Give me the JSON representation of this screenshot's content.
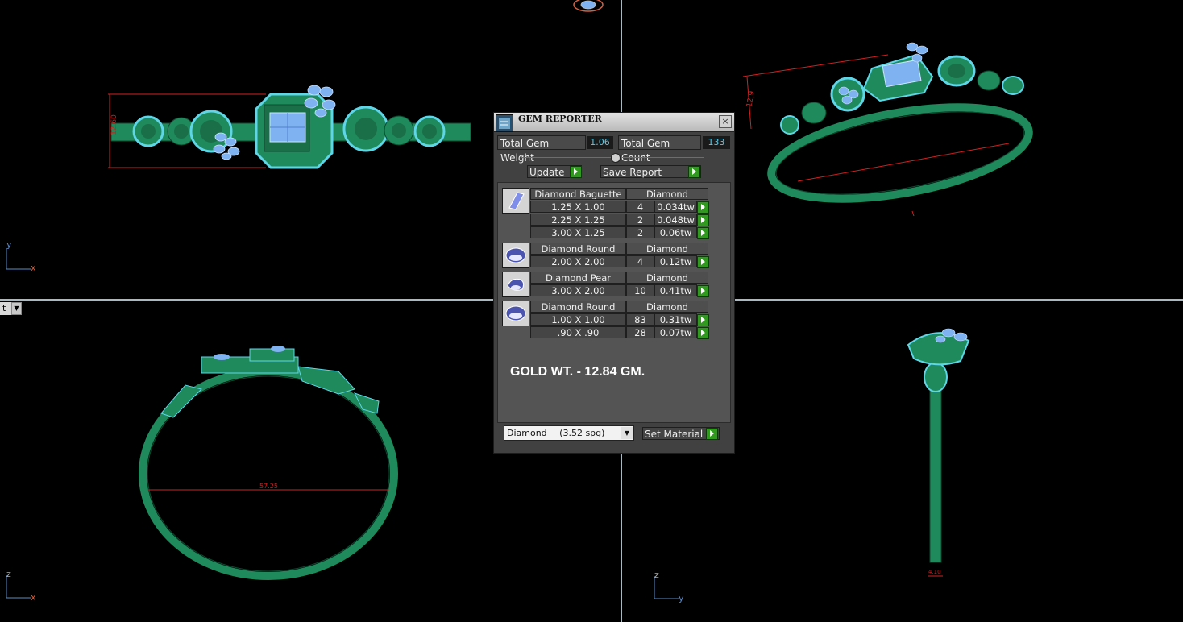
{
  "app": {
    "viewport_menu_label": "t",
    "axes": {
      "top_left": [
        "y",
        "x"
      ],
      "bottom_left": [
        "z",
        "x"
      ],
      "bottom_right": [
        "z",
        "y"
      ]
    },
    "dims": {
      "top_left_height": "12.60",
      "top_right_small": "12.9",
      "bottom_left_width": "57.25",
      "bottom_right_small": "4.10"
    }
  },
  "gem_reporter": {
    "title": "GEM REPORTER",
    "close_label": "×",
    "total_weight_label": "Total Gem Weight",
    "total_weight_value": "1.06",
    "total_count_label": "Total Gem Count",
    "total_count_value": "133",
    "update_label": "Update",
    "save_report_label": "Save Report",
    "groups": [
      {
        "icon": "baguette-gem-icon",
        "name": "Diamond Baguette",
        "material": "Diamond",
        "rows": [
          {
            "size": "1.25 X 1.00",
            "count": "4",
            "weight": "0.034tw"
          },
          {
            "size": "2.25 X 1.25",
            "count": "2",
            "weight": "0.048tw"
          },
          {
            "size": "3.00 X 1.25",
            "count": "2",
            "weight": "0.06tw"
          }
        ]
      },
      {
        "icon": "round-gem-icon",
        "name": "Diamond Round",
        "material": "Diamond",
        "rows": [
          {
            "size": "2.00 X 2.00",
            "count": "4",
            "weight": "0.12tw"
          }
        ]
      },
      {
        "icon": "pear-gem-icon",
        "name": "Diamond Pear",
        "material": "Diamond",
        "rows": [
          {
            "size": "3.00 X 2.00",
            "count": "10",
            "weight": "0.41tw"
          }
        ]
      },
      {
        "icon": "round-gem-icon",
        "name": "Diamond Round",
        "material": "Diamond",
        "rows": [
          {
            "size": "1.00 X 1.00",
            "count": "83",
            "weight": "0.31tw"
          },
          {
            "size": ".90 X .90",
            "count": "28",
            "weight": "0.07tw"
          }
        ]
      }
    ],
    "gold_weight_text": "GOLD WT. - 12.84 GM.",
    "material_select": {
      "name": "Diamond",
      "spg": "(3.52 spg)"
    },
    "set_material_label": "Set Material"
  },
  "colors": {
    "metal": "#1f8a5c",
    "gem": "#7fb2f0",
    "pave": "#5fd6e8",
    "dimension": "#d41f1f",
    "accent_value": "#5ec9e6",
    "go_button": "#2f9a1e"
  }
}
